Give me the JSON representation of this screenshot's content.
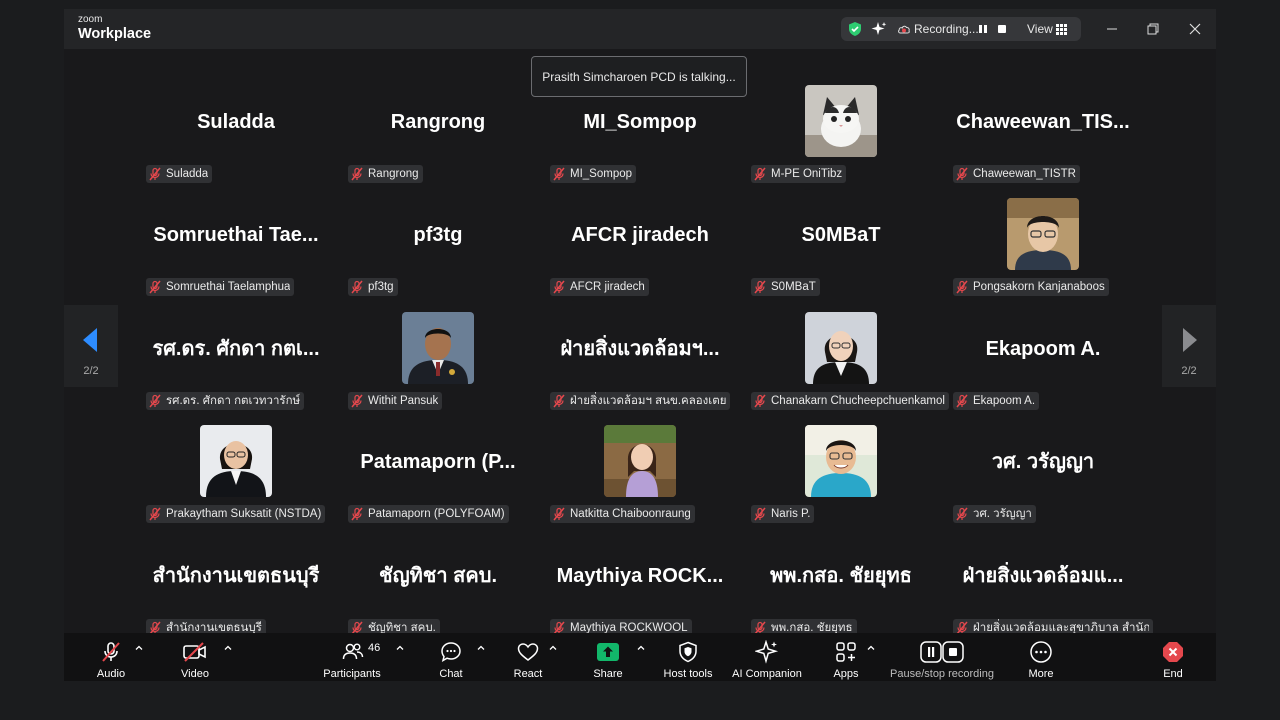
{
  "app": {
    "logo_small": "zoom",
    "logo_main": "Workplace"
  },
  "topbar": {
    "recording_text": "Recording...",
    "view_label": "View"
  },
  "talking_notice": "Prasith Simcharoen PCD is talking...",
  "pager": {
    "left_page": "2/2",
    "right_page": "2/2"
  },
  "tiles": [
    {
      "big": "Suladda",
      "name": "Suladda",
      "photo": ""
    },
    {
      "big": "Rangrong",
      "name": "Rangrong",
      "photo": ""
    },
    {
      "big": "MI_Sompop",
      "name": "MI_Sompop",
      "photo": ""
    },
    {
      "big": "",
      "name": "M-PE OniTibz",
      "photo": "cat-photo"
    },
    {
      "big": "Chaweewan_TIS...",
      "name": "Chaweewan_TISTR",
      "photo": ""
    },
    {
      "big": "Somruethai  Tae...",
      "name": "Somruethai Taelamphua",
      "photo": ""
    },
    {
      "big": "pf3tg",
      "name": "pf3tg",
      "photo": ""
    },
    {
      "big": "AFCR jiradech",
      "name": "AFCR jiradech",
      "photo": ""
    },
    {
      "big": "S0MBaT",
      "name": "S0MBaT",
      "photo": ""
    },
    {
      "big": "",
      "name": "Pongsakorn Kanjanaboos",
      "photo": "person-photo"
    },
    {
      "big": "รศ.ดร. ศักดา กตเ...",
      "name": "รศ.ดร. ศักดา กตเวทวารักษ์",
      "photo": ""
    },
    {
      "big": "",
      "name": "Withit Pansuk",
      "photo": "person-photo"
    },
    {
      "big": "ฝ่ายสิ่งแวดล้อมฯ...",
      "name": "ฝ่ายสิ่งแวดล้อมฯ สนข.คลองเตย",
      "photo": ""
    },
    {
      "big": "",
      "name": "Chanakarn Chucheepchuenkamol",
      "photo": "person-photo"
    },
    {
      "big": "Ekapoom A.",
      "name": "Ekapoom A.",
      "photo": ""
    },
    {
      "big": "",
      "name": "Prakaytham Suksatit (NSTDA)",
      "photo": "person-photo"
    },
    {
      "big": "Patamaporn  (P...",
      "name": "Patamaporn (POLYFOAM)",
      "photo": ""
    },
    {
      "big": "",
      "name": "Natkitta Chaiboonraung",
      "photo": "person-photo"
    },
    {
      "big": "",
      "name": "Naris P.",
      "photo": "person-photo"
    },
    {
      "big": "วศ. วรัญญา",
      "name": "วศ. วรัญญา",
      "photo": ""
    },
    {
      "big": "สำนักงานเขตธนบุรี",
      "name": "สำนักงานเขตธนบุรี",
      "photo": ""
    },
    {
      "big": "ชัญทิชา สคบ.",
      "name": "ชัญทิชา สคบ.",
      "photo": ""
    },
    {
      "big": "Maythiya  ROCK...",
      "name": "Maythiya ROCKWOOL",
      "photo": ""
    },
    {
      "big": "พพ.กสอ. ชัยยุทธ",
      "name": "พพ.กสอ. ชัยยุทธ",
      "photo": ""
    },
    {
      "big": "ฝ่ายสิ่งแวดล้อมแ...",
      "name": "ฝ่ายสิ่งแวดล้อมและสุขาภิบาล สำนักงาน...",
      "photo": ""
    }
  ],
  "toolbar": {
    "audio": "Audio",
    "video": "Video",
    "participants": "Participants",
    "participants_count": "46",
    "chat": "Chat",
    "react": "React",
    "share": "Share",
    "host_tools": "Host tools",
    "ai_companion": "AI Companion",
    "apps": "Apps",
    "pause_stop": "Pause/stop recording",
    "more": "More",
    "end": "End"
  },
  "colors": {
    "accent_blue": "#2d8cff",
    "share_green": "#12b76a",
    "end_red": "#e5484d",
    "muted_red": "#e5484d",
    "shield_green": "#2ecc71"
  }
}
